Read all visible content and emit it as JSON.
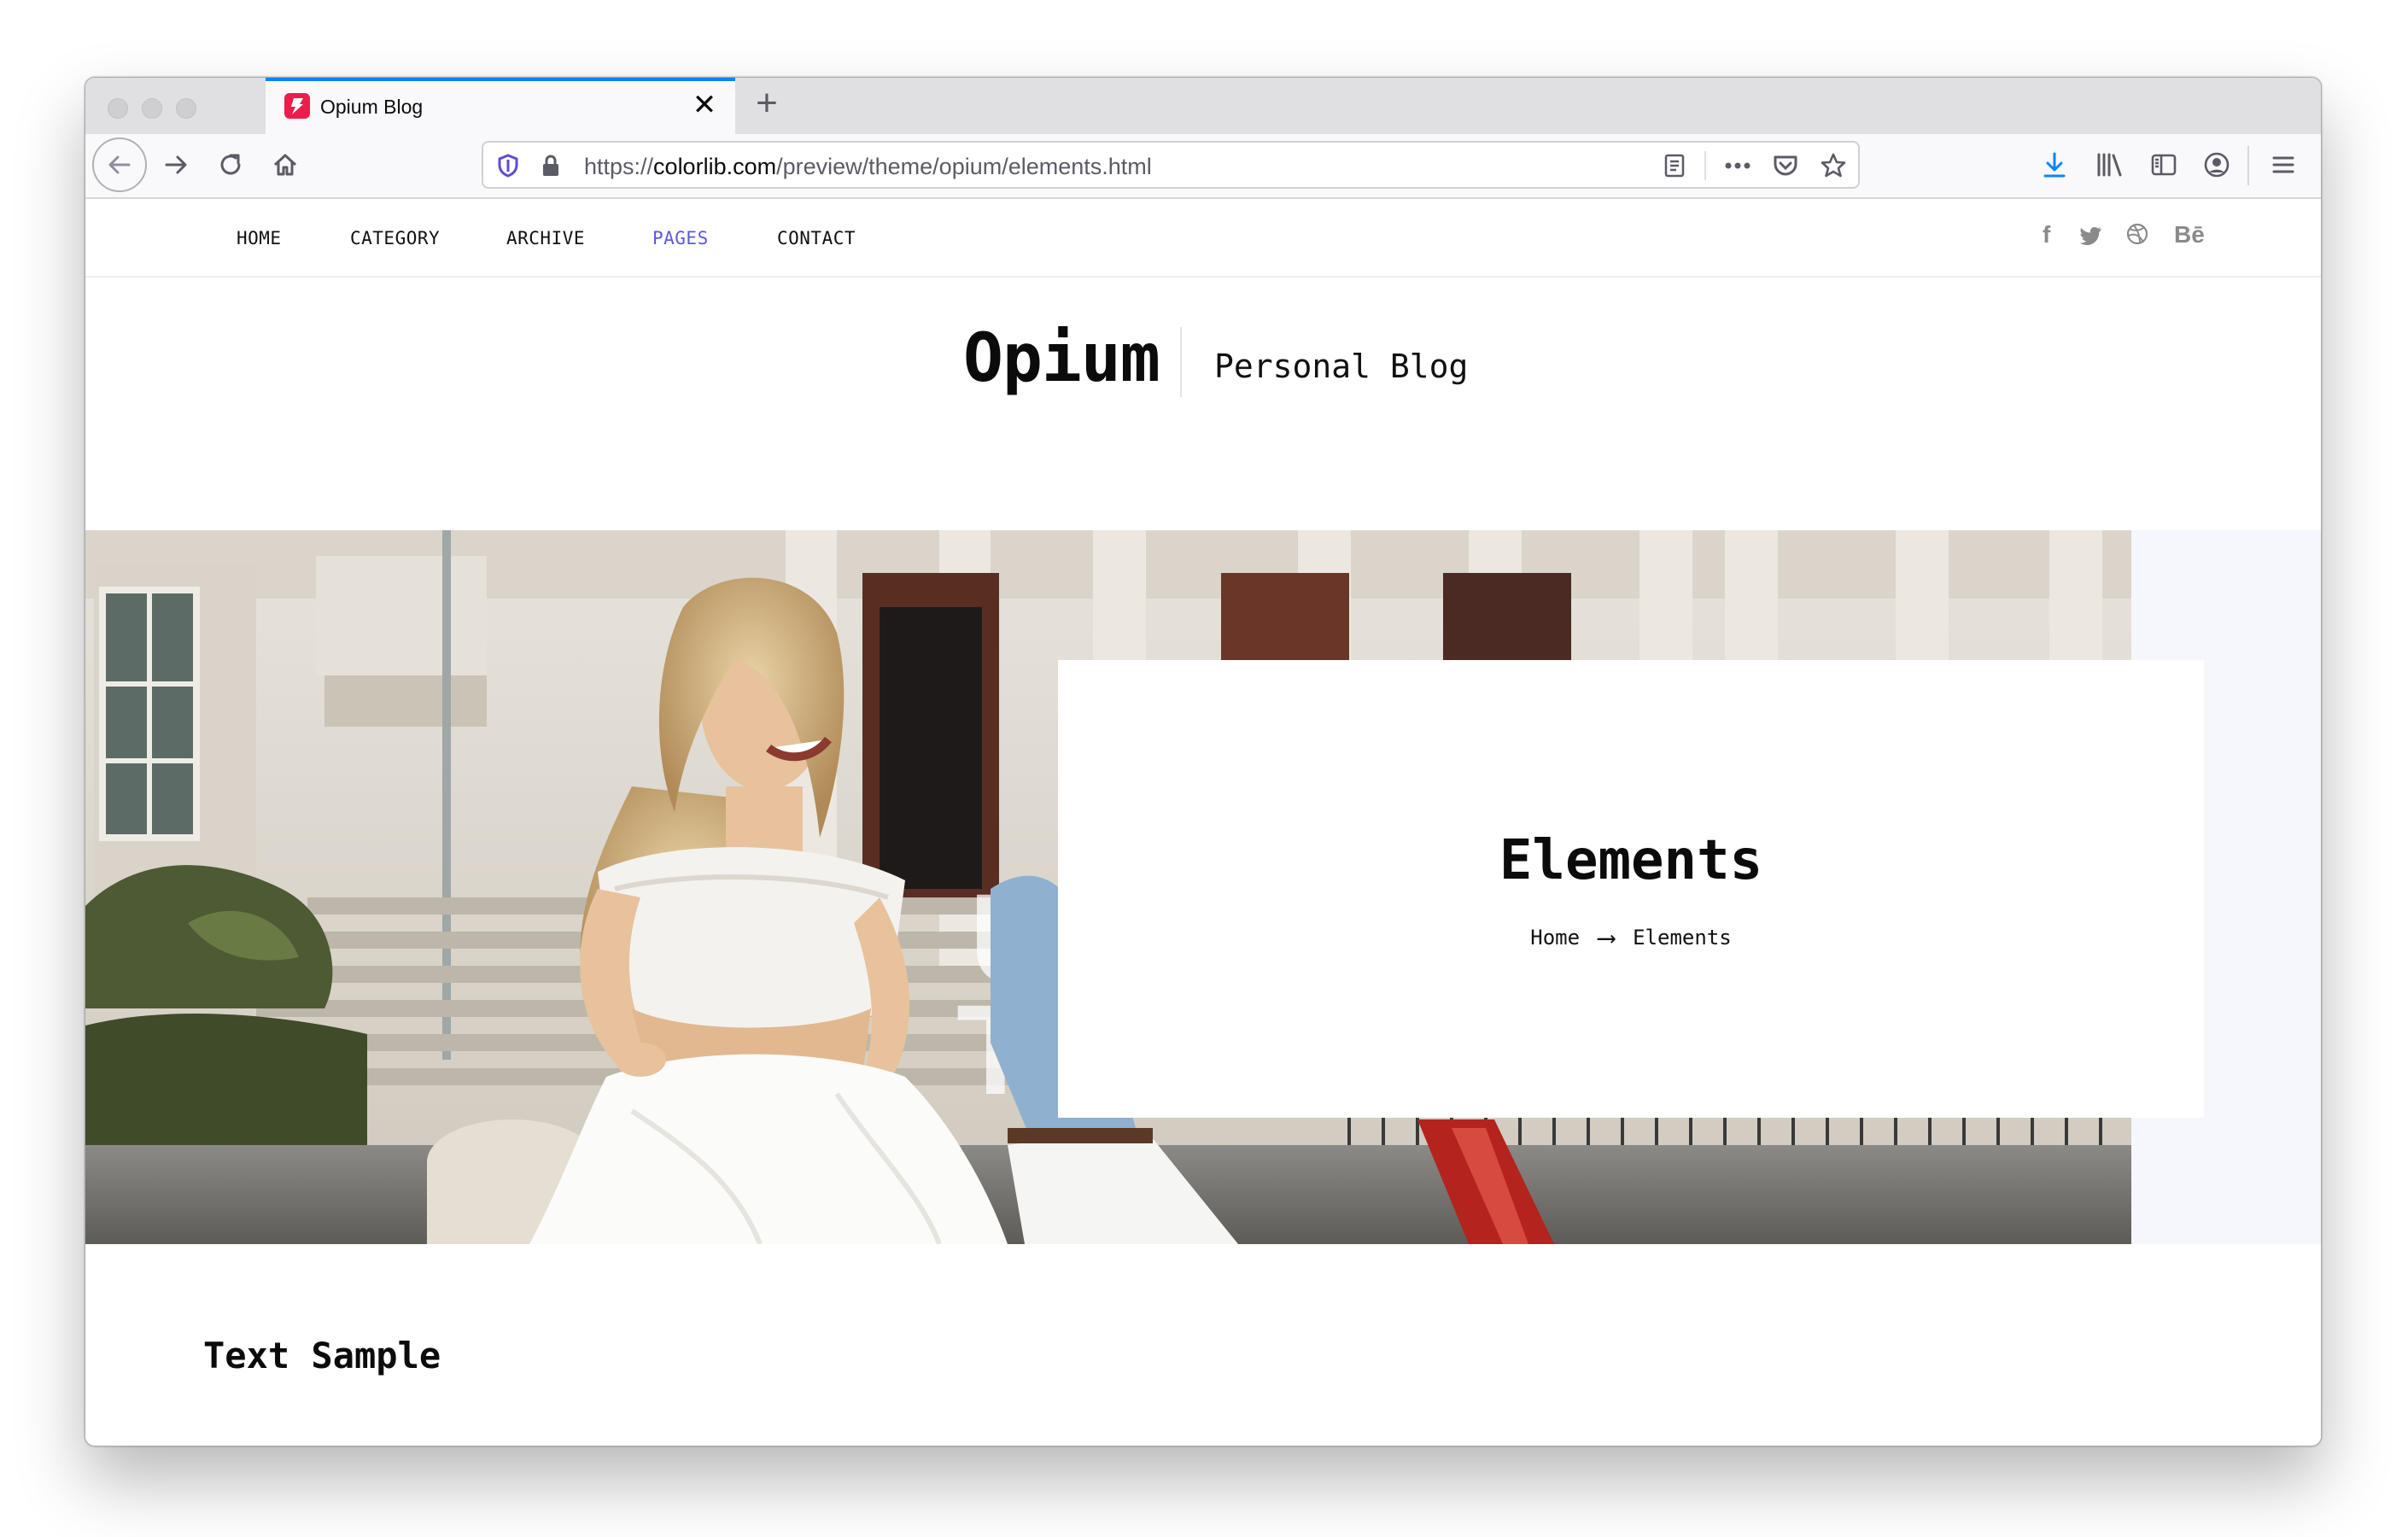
{
  "browser": {
    "tab_title": "Opium Blog",
    "tab_close": "✕",
    "new_tab": "+",
    "url_prefix": "https://",
    "url_domain": "colorlib.com",
    "url_path": "/preview/theme/opium/elements.html"
  },
  "nav": {
    "items": [
      "HOME",
      "CATEGORY",
      "ARCHIVE",
      "PAGES",
      "CONTACT"
    ],
    "active": "PAGES",
    "social": [
      "f",
      "twitter-icon",
      "dribbble-icon",
      "Bē"
    ]
  },
  "brand": {
    "logo": "Opium",
    "tagline": "Personal Blog"
  },
  "hero": {
    "title": "Elements",
    "crumb_home": "Home",
    "crumb_arrow": "⟶",
    "crumb_current": "Elements"
  },
  "content": {
    "section_title": "Text Sample"
  },
  "colors": {
    "accent_blue": "#0a84ff",
    "active_nav": "#5b5bd6",
    "favicon": "#ed1c4d"
  }
}
